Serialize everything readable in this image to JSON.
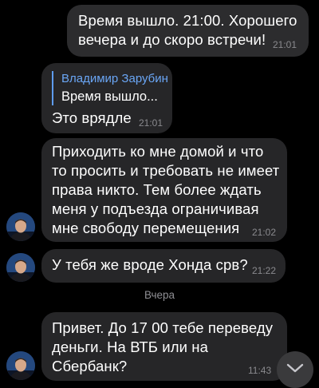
{
  "messages": [
    {
      "direction": "outgoing",
      "lines": [
        "Время вышло. 21:00. Хорошего",
        "вечера и до скоро встречи!"
      ],
      "time": "21:01"
    },
    {
      "direction": "incoming",
      "reply": {
        "author": "Владимир Зарубин",
        "preview": "Время вышло..."
      },
      "lines": [
        "Это врядле"
      ],
      "time": "21:01"
    },
    {
      "direction": "incoming",
      "lines": [
        "Приходить ко мне домой и что",
        "то просить и требовать не имеет",
        "права никто. Тем более ждать",
        "меня у подъезда ограничивая",
        "мне свободу перемещения"
      ],
      "time": "21:02"
    },
    {
      "direction": "incoming",
      "lines": [
        "У тебя же вроде Хонда срв?"
      ],
      "time": "21:22"
    },
    {
      "direction": "incoming",
      "lines": [
        "Привет. До 17 00 тебе переведу",
        "деньги. На ВТБ или на",
        "Сбербанк?"
      ],
      "time": "11:43"
    }
  ],
  "date_separator": "Вчера",
  "icons": {
    "avatar": "user-avatar",
    "scroll_down": "chevron-down-icon"
  },
  "colors": {
    "background": "#000000",
    "bubble": "#262628",
    "reply_accent": "#5e9cf0",
    "time": "#8a8a8e"
  }
}
